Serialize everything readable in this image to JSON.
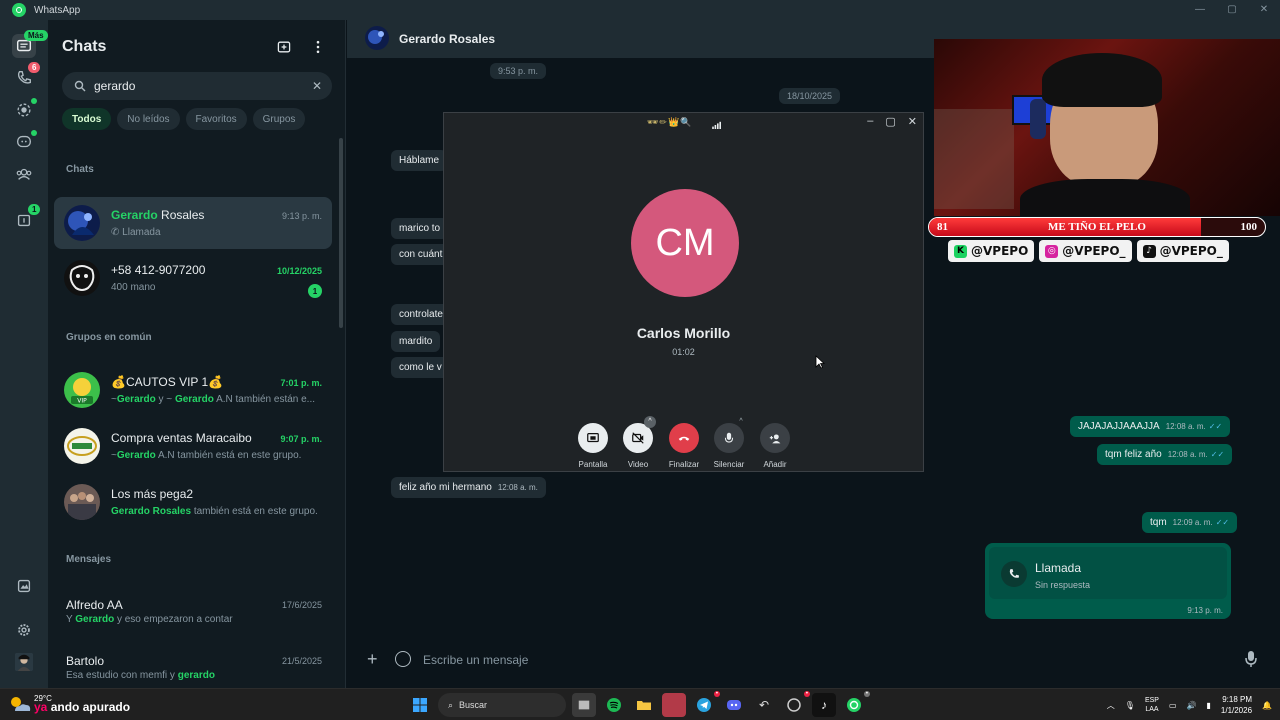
{
  "window": {
    "title": "WhatsApp",
    "controls": [
      "—",
      "▢",
      "✕"
    ]
  },
  "rail": {
    "badges": {
      "chats": "Más",
      "calls": "6",
      "communities_new": "1"
    }
  },
  "chatlist": {
    "title": "Chats",
    "search": {
      "value": "gerardo",
      "placeholder": "Buscar"
    },
    "filters": [
      "Todos",
      "No leídos",
      "Favoritos",
      "Grupos"
    ],
    "sections": {
      "chats": "Chats",
      "groups": "Grupos en común",
      "messages": "Mensajes"
    },
    "chats": [
      {
        "name_hl": "Gerardo",
        "name_rest": " Rosales",
        "sub": "Llamada",
        "time": "9:13 p. m."
      },
      {
        "name": "+58 412-9077200",
        "sub": "400 mano",
        "time": "10/12/2025",
        "unread": "1"
      }
    ],
    "groups": [
      {
        "name": "💰CAUTOS VIP 1💰",
        "time": "7:01 p. m.",
        "sub_a": "~",
        "sub_b": "Gerardo",
        "sub_c": " y ~ ",
        "sub_d": "Gerardo",
        "sub_e": " A.N",
        "sub_f": " también están e..."
      },
      {
        "name": "Compra ventas Maracaibo",
        "time": "9:07 p. m.",
        "sub_a": "~",
        "sub_b": "Gerardo",
        "sub_e": " A.N",
        "sub_f": " también está en este grupo."
      },
      {
        "name": "Los más pega2",
        "sub_b": "Gerardo",
        "sub_e": " Rosales",
        "sub_f": " también está en este grupo."
      }
    ],
    "messages": [
      {
        "name": "Alfredo AA",
        "time": "17/6/2025",
        "sub_a": "Y ",
        "sub_b": "Gerardo",
        "sub_f": " y eso empezaron a contar"
      },
      {
        "name": "Bartolo",
        "time": "21/5/2025",
        "sub_a": "Esa estudio con memfi y ",
        "sub_b": "gerardo"
      }
    ]
  },
  "conversation": {
    "contact": "Gerardo Rosales",
    "date_chip_top": "9:53 p. m.",
    "date_chip": "18/10/2025",
    "incoming": [
      "Háblame",
      "marico to",
      "con cuánt",
      "controlate",
      "mardito",
      "como le v"
    ],
    "last_incoming": {
      "text": "feliz año mi hermano",
      "time": "12:08 a. m."
    },
    "outgoing": [
      {
        "text": "JAJAJAJJAAAJJA",
        "time": "12:08 a. m."
      },
      {
        "text": "tqm feliz año",
        "time": "12:08 a. m."
      },
      {
        "text": "tqm",
        "time": "12:09 a. m."
      }
    ],
    "call_bubble": {
      "title": "Llamada",
      "sub": "Sin respuesta",
      "time": "9:13 p. m."
    },
    "composer_placeholder": "Escribe un mensaje"
  },
  "call": {
    "emojis": "🕶✏👑🔍",
    "initials": "CM",
    "name": "Carlos Morillo",
    "duration": "01:02",
    "buttons": [
      "Pantalla",
      "Video",
      "Finalizar",
      "Silenciar",
      "Añadir"
    ]
  },
  "stream_overlay": {
    "bar_left": "81",
    "bar_text": "ME TIÑO EL PELO",
    "bar_right": "100",
    "bar_fill_fraction": 0.81,
    "handles": [
      "@VPEPO",
      "@VPEPO_",
      "@VPEPO_"
    ]
  },
  "taskbar": {
    "temp": "29°C",
    "song_prefix": "ya",
    "song": "ando apurado",
    "search": "Buscar",
    "lang_top": "ESP",
    "lang_bottom": "LAA",
    "time": "9:18 PM",
    "date": "1/1/2026"
  },
  "colors": {
    "accent": "#25d366",
    "outgoing": "#005c4b",
    "end_call": "#e03e4a",
    "avatar_cm": "#d4587c"
  }
}
